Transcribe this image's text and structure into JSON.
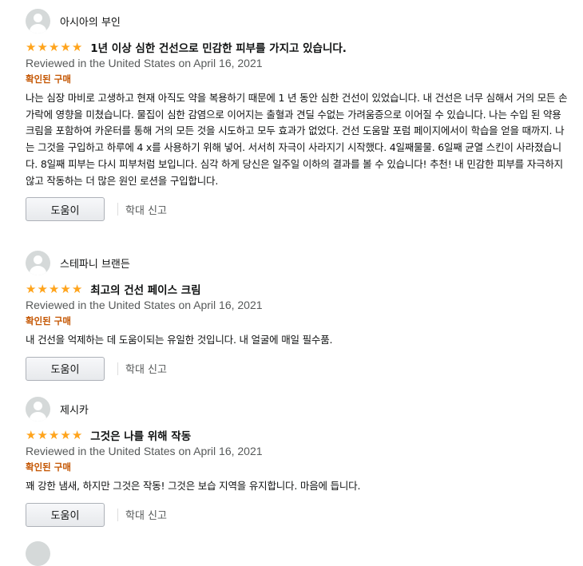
{
  "reviews": [
    {
      "author": "아시아의 부인",
      "rating": 5,
      "title": "1년 이상 심한 건선으로 민감한 피부를 가지고 있습니다.",
      "date": "Reviewed in the United States on April 16, 2021",
      "verified": "확인된 구매",
      "body": "나는 심장 마비로 고생하고 현재 아직도 약을 복용하기 때문에 1 년 동안 심한 건선이 있었습니다. 내 건선은 너무 심해서 거의 모든 손가락에 영향을 미쳤습니다. 물집이 심한 감염으로 이어지는 출혈과 견딜 수없는 가려움증으로 이어질 수 있습니다. 나는 수입 된 약용 크림을 포함하여 카운터를 통해 거의 모든 것을 시도하고 모두 효과가 없었다. 건선 도움말 포럼 페이지에서이 학습을 얻을 때까지. 나는 그것을 구입하고 하루에 4 x를 사용하기 위해 넣어. 서서히 자극이 사라지기 시작했다. 4일째물물. 6일째 균열 스킨이 사라졌습니다. 8일째 피부는 다시 피부처럼 보입니다. 심각 하게 당신은 일주일 이하의 결과를 볼 수 있습니다! 추천! 내 민감한 피부를 자극하지 않고 작동하는 더 많은 원인 로션을 구입합니다.",
      "helpful_label": "도움이",
      "report_label": "학대 신고"
    },
    {
      "author": "스테파니 브랜든",
      "rating": 5,
      "title": "최고의 건선 페이스 크림",
      "date": "Reviewed in the United States on April 16, 2021",
      "verified": "확인된 구매",
      "body": "내 건선을 억제하는 데 도움이되는 유일한 것입니다. 내 얼굴에 매일 필수품.",
      "helpful_label": "도움이",
      "report_label": "학대 신고"
    },
    {
      "author": "제시카",
      "rating": 5,
      "title": "그것은 나를 위해 작동",
      "date": "Reviewed in the United States on April 16, 2021",
      "verified": "확인된 구매",
      "body": "꽤 강한 냄새, 하지만 그것은 작동! 그것은 보습 지역을 유지합니다. 마음에 듭니다.",
      "helpful_label": "도움이",
      "report_label": "학대 신고"
    }
  ],
  "colors": {
    "star": "#ffa41c",
    "verified": "#c45500",
    "meta": "#565959"
  }
}
